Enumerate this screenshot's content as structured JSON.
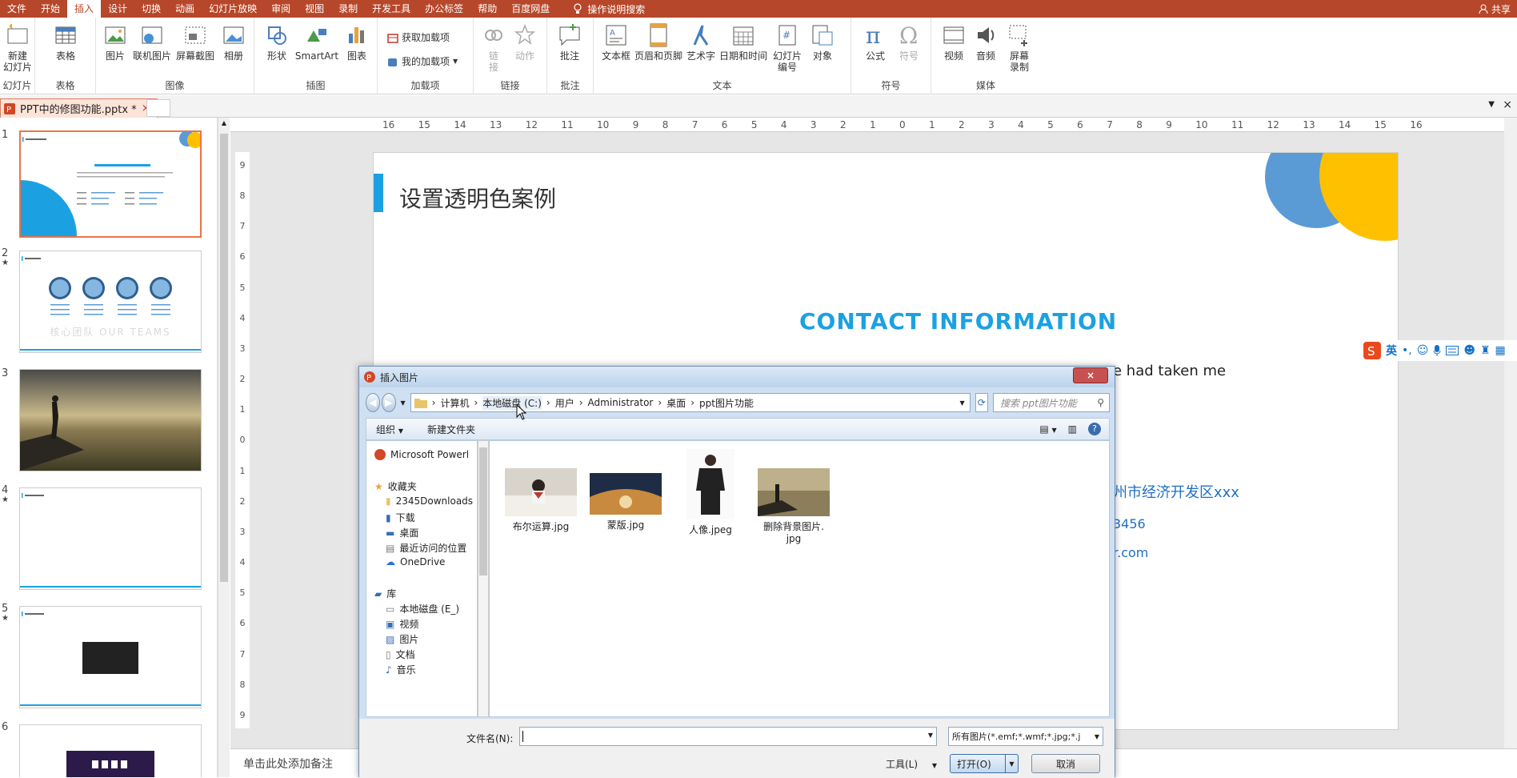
{
  "ribbon_tabs": [
    "文件",
    "开始",
    "插入",
    "设计",
    "切换",
    "动画",
    "幻灯片放映",
    "审阅",
    "视图",
    "录制",
    "开发工具",
    "办公标签",
    "帮助",
    "百度网盘"
  ],
  "active_tab": "插入",
  "tell_me": "操作说明搜索",
  "share": "共享",
  "groups": {
    "slides": {
      "label": "幻灯片",
      "new_slide": "新建\n幻灯片"
    },
    "tables": {
      "label": "表格",
      "table": "表格"
    },
    "images": {
      "label": "图像",
      "picture": "图片",
      "online_picture": "联机图片",
      "screenshot": "屏幕截图",
      "album": "相册"
    },
    "illustrations": {
      "label": "插图",
      "shapes": "形状",
      "smartart": "SmartArt",
      "chart": "图表"
    },
    "addins": {
      "label": "加载项",
      "get": "获取加载项",
      "my": "我的加载项"
    },
    "links": {
      "label": "链接",
      "link": "链\n接",
      "action": "动作"
    },
    "comments": {
      "label": "批注",
      "comment": "批注"
    },
    "text": {
      "label": "文本",
      "textbox": "文本框",
      "header_footer": "页眉和页脚",
      "wordart": "艺术字",
      "datetime": "日期和时间",
      "slide_number": "幻灯片\n编号",
      "object": "对象"
    },
    "symbols": {
      "label": "符号",
      "equation": "公式",
      "symbol": "符号"
    },
    "media": {
      "label": "媒体",
      "video": "视频",
      "audio": "音频",
      "screen_record": "屏幕\n录制"
    }
  },
  "doc_tab": "PPT中的修图功能.pptx *",
  "thumbnails": [
    {
      "num": "1"
    },
    {
      "num": "2",
      "text": "核心团队  OUR TEAMS"
    },
    {
      "num": "3"
    },
    {
      "num": "4"
    },
    {
      "num": "5"
    },
    {
      "num": "6"
    }
  ],
  "ruler_h": [
    "16",
    "15",
    "14",
    "13",
    "12",
    "11",
    "10",
    "9",
    "8",
    "7",
    "6",
    "5",
    "4",
    "3",
    "2",
    "1",
    "0",
    "1",
    "2",
    "3",
    "4",
    "5",
    "6",
    "7",
    "8",
    "9",
    "10",
    "11",
    "12",
    "13",
    "14",
    "15",
    "16"
  ],
  "ruler_v": [
    "9",
    "8",
    "7",
    "6",
    "5",
    "4",
    "3",
    "2",
    "1",
    "0",
    "1",
    "2",
    "3",
    "4",
    "5",
    "6",
    "7",
    "8",
    "9"
  ],
  "slide": {
    "title": "设置透明色案例",
    "contact_heading": "CONTACT INFORMATION",
    "body_fragment": "e had taken me",
    "addr_fragment": "州市经济开发区xxx",
    "phone_fragment": "3456",
    "email_fragment": "r.com"
  },
  "notes_placeholder": "单击此处添加备注",
  "ime": {
    "lang": "英"
  },
  "dialog": {
    "title": "插入图片",
    "address": [
      "计算机",
      "本地磁盘 (C:)",
      "用户",
      "Administrator",
      "桌面",
      "ppt图片功能"
    ],
    "search_placeholder": "搜索 ppt图片功能",
    "organize": "组织",
    "new_folder": "新建文件夹",
    "nav_items": [
      {
        "label": "Microsoft Powerl"
      },
      {
        "label": "收藏夹"
      },
      {
        "label": "2345Downloads"
      },
      {
        "label": "下载"
      },
      {
        "label": "桌面"
      },
      {
        "label": "最近访问的位置"
      },
      {
        "label": "OneDrive"
      },
      {
        "label": "库"
      },
      {
        "label": "本地磁盘 (E_)"
      },
      {
        "label": "视频"
      },
      {
        "label": "图片"
      },
      {
        "label": "文档"
      },
      {
        "label": "音乐"
      }
    ],
    "files": [
      "布尔运算.jpg",
      "蒙版.jpg",
      "人像.jpeg",
      "删除背景图片.\njpg"
    ],
    "filename_label": "文件名(N):",
    "filename_value": "",
    "filetype": "所有图片(*.emf;*.wmf;*.jpg;*.j",
    "tools": "工具(L)",
    "open": "打开(O)",
    "cancel": "取消"
  },
  "colors": {
    "accent": "#b7472a",
    "slide_blue": "#1ba1e2",
    "slide_yellow": "#ffc000",
    "slide_lightblue": "#5b9bd5",
    "link_blue": "#1f6fc4"
  }
}
